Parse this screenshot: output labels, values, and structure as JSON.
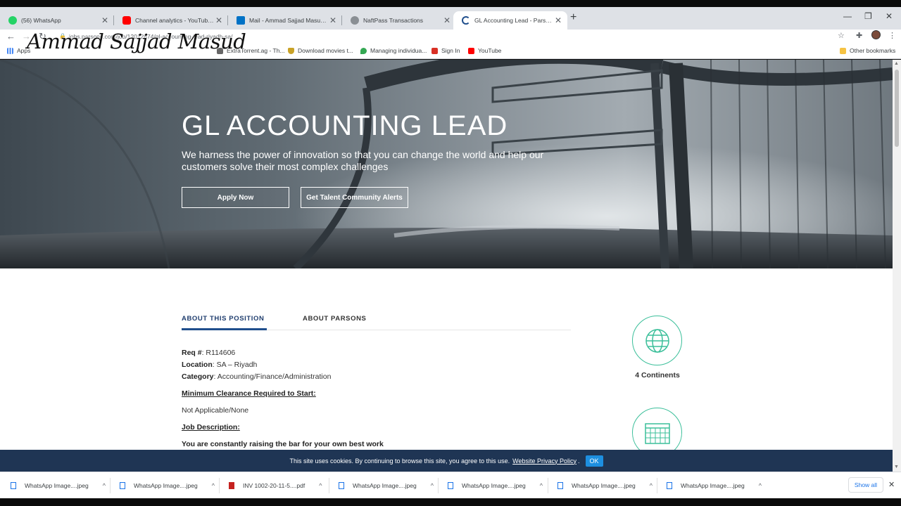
{
  "browser": {
    "tabs": [
      {
        "title": "(56) WhatsApp",
        "favicon_color": "#25d366"
      },
      {
        "title": "Channel analytics - YouTube Stu",
        "favicon_color": "#ff0000"
      },
      {
        "title": "Mail - Ammad Sajjad Masud - Ou",
        "favicon_color": "#0072c6"
      },
      {
        "title": "NaftPass Transactions",
        "favicon_color": "#5f6368"
      },
      {
        "title": "GL Accounting Lead - Parsons Ca",
        "favicon_color": "#1f4e8c",
        "active": true
      }
    ],
    "url": "jobs.parsons.com/job/12012874/gl-accounting-lead-riyadh-sa/",
    "bookmarks": [
      {
        "label": "Apps",
        "icon": "apps-grid-icon"
      },
      {
        "label": "ExtraTorrent.ag - Th...",
        "icon": "torrent-icon"
      },
      {
        "label": "Download movies t...",
        "icon": "shield-icon"
      },
      {
        "label": "Managing individua...",
        "icon": "map-pin-icon"
      },
      {
        "label": "Sign In",
        "icon": "signin-icon"
      },
      {
        "label": "YouTube",
        "icon": "youtube-icon"
      }
    ],
    "other_bookmarks": "Other bookmarks",
    "watermark": "Ammad Sajjad Masud"
  },
  "hero": {
    "title": "GL ACCOUNTING LEAD",
    "subtitle": "We harness the power of innovation so that you can change the world and help our customers solve their most complex challenges",
    "apply_label": "Apply Now",
    "alerts_label": "Get Talent Community Alerts"
  },
  "page_tabs": {
    "about_position": "ABOUT THIS POSITION",
    "about_parsons": "ABOUT PARSONS"
  },
  "details": {
    "req_label": "Req #",
    "req_value": ": R114606",
    "location_label": "Location",
    "location_value": ": SA – Riyadh",
    "category_label": "Category",
    "category_value": ": Accounting/Finance/Administration",
    "clearance_heading": "Minimum Clearance Required to Start:",
    "clearance_value": "Not Applicable/None",
    "job_desc_heading": "Job Description:",
    "tagline": "You are constantly raising the bar for your own best work"
  },
  "stats": {
    "continents_label": "4 Continents",
    "accent_color": "#3bbf9a"
  },
  "cookie": {
    "text": "This site uses cookies. By continuing to browse this site, you agree to this use.",
    "link": "Website Privacy Policy",
    "after_link": ".",
    "ok": "OK"
  },
  "downloads": {
    "items": [
      {
        "name": "WhatsApp Image....jpeg",
        "type": "image"
      },
      {
        "name": "WhatsApp Image....jpeg",
        "type": "image"
      },
      {
        "name": "INV 1002-20-11-5....pdf",
        "type": "pdf"
      },
      {
        "name": "WhatsApp Image....jpeg",
        "type": "image"
      },
      {
        "name": "WhatsApp Image....jpeg",
        "type": "image"
      },
      {
        "name": "WhatsApp Image....jpeg",
        "type": "image"
      },
      {
        "name": "WhatsApp Image....jpeg",
        "type": "image"
      }
    ],
    "show_all": "Show all"
  }
}
